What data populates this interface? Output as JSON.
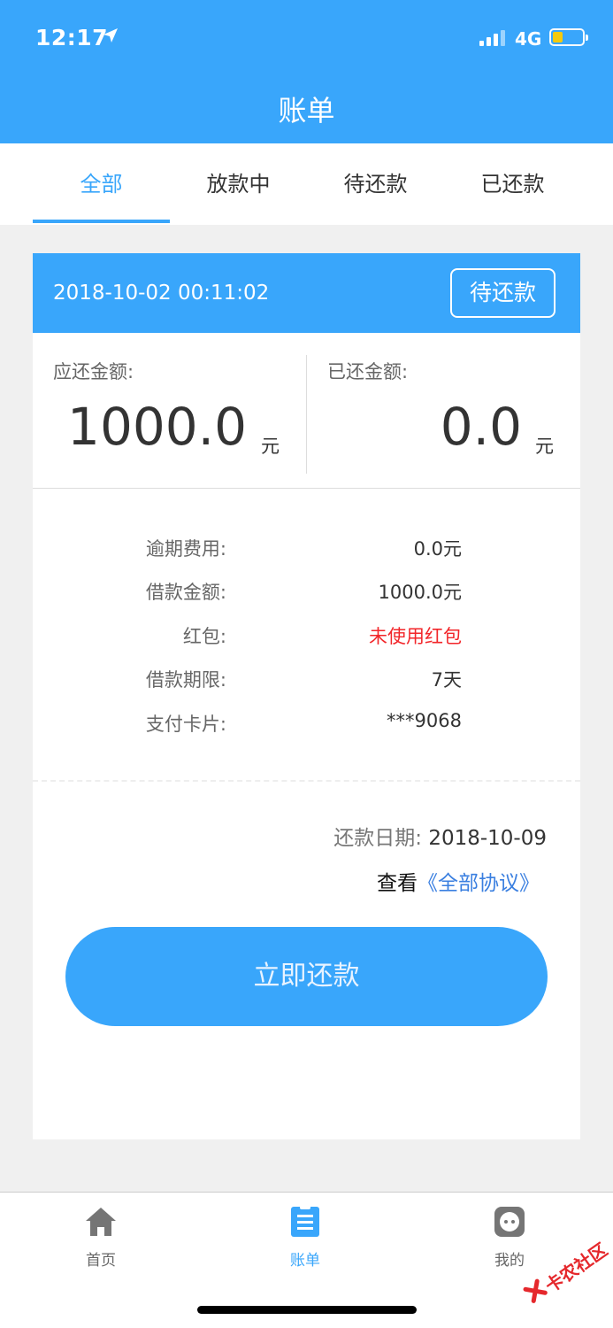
{
  "status_bar": {
    "time": "12:17",
    "network": "4G",
    "battery_level": 0.35,
    "battery_color": "#ffcc00"
  },
  "header": {
    "title": "账单",
    "bg_color": "#39a6fb"
  },
  "tabs": [
    {
      "label": "全部",
      "active": true
    },
    {
      "label": "放款中",
      "active": false
    },
    {
      "label": "待还款",
      "active": false
    },
    {
      "label": "已还款",
      "active": false
    }
  ],
  "bill": {
    "datetime": "2018-10-02 00:11:02",
    "status": "待还款",
    "due_amount_label": "应还金额:",
    "due_amount": "1000.0",
    "paid_amount_label": "已还金额:",
    "paid_amount": "0.0",
    "unit": "元",
    "details": [
      {
        "label": "逾期费用:",
        "value": "0.0元",
        "highlight": false
      },
      {
        "label": "借款金额:",
        "value": "1000.0元",
        "highlight": false
      },
      {
        "label": "红包:",
        "value": "未使用红包",
        "highlight": true
      },
      {
        "label": "借款期限:",
        "value": "7天",
        "highlight": false
      },
      {
        "label": "支付卡片:",
        "value": "***9068",
        "highlight": false
      }
    ],
    "repay_date_label": "还款日期:",
    "repay_date": "2018-10-09",
    "agreement_prefix": "查看",
    "agreement_link": "《全部协议》",
    "pay_button": "立即还款"
  },
  "tabbar": [
    {
      "label": "首页",
      "icon": "home-icon",
      "active": false
    },
    {
      "label": "账单",
      "icon": "bill-list-icon",
      "active": true
    },
    {
      "label": "我的",
      "icon": "profile-icon",
      "active": false
    }
  ],
  "watermark": "卡农社区",
  "colors": {
    "accent": "#39a6fb",
    "highlight_red": "#f2262a",
    "link_blue": "#3a7fe0"
  }
}
